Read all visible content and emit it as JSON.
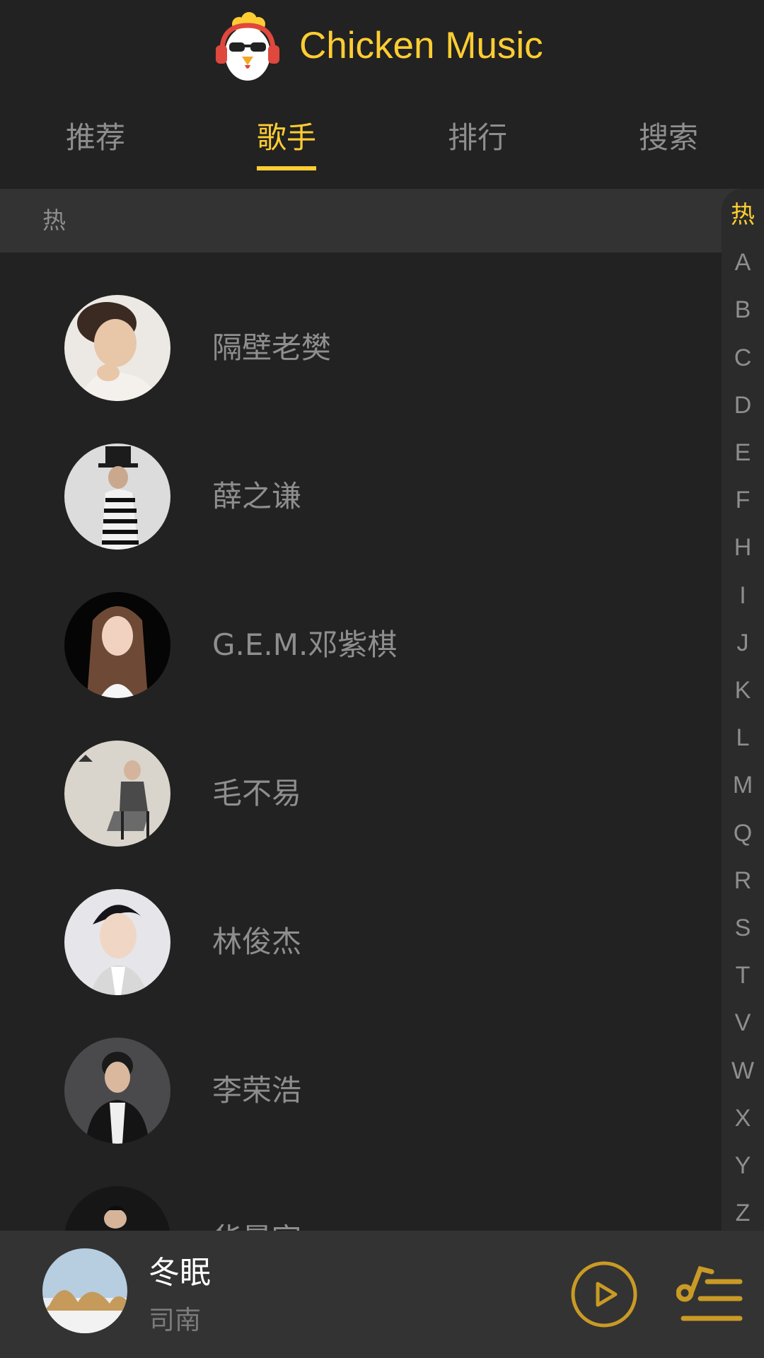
{
  "header": {
    "title": "Chicken Music",
    "logo_icon": "chicken-headphones-logo",
    "accent_color": "#ffcd32"
  },
  "tabs": [
    {
      "label": "推荐",
      "active": false
    },
    {
      "label": "歌手",
      "active": true
    },
    {
      "label": "排行",
      "active": false
    },
    {
      "label": "搜索",
      "active": false
    }
  ],
  "group": {
    "title": "热"
  },
  "singers": [
    {
      "name": "隔壁老樊",
      "avatar_icon": "singer-avatar"
    },
    {
      "name": "薛之谦",
      "avatar_icon": "singer-avatar"
    },
    {
      "name": "G.E.M.邓紫棋",
      "avatar_icon": "singer-avatar"
    },
    {
      "name": "毛不易",
      "avatar_icon": "singer-avatar"
    },
    {
      "name": "林俊杰",
      "avatar_icon": "singer-avatar"
    },
    {
      "name": "李荣浩",
      "avatar_icon": "singer-avatar"
    },
    {
      "name": "华晨宇",
      "avatar_icon": "singer-avatar"
    }
  ],
  "shortcut": {
    "items": [
      "热",
      "A",
      "B",
      "C",
      "D",
      "E",
      "F",
      "H",
      "I",
      "J",
      "K",
      "L",
      "M",
      "Q",
      "R",
      "S",
      "T",
      "V",
      "W",
      "X",
      "Y",
      "Z"
    ],
    "active": "热"
  },
  "mini_player": {
    "song": "冬眠",
    "artist": "司南",
    "play_icon": "play-icon",
    "playlist_icon": "playlist-icon"
  }
}
